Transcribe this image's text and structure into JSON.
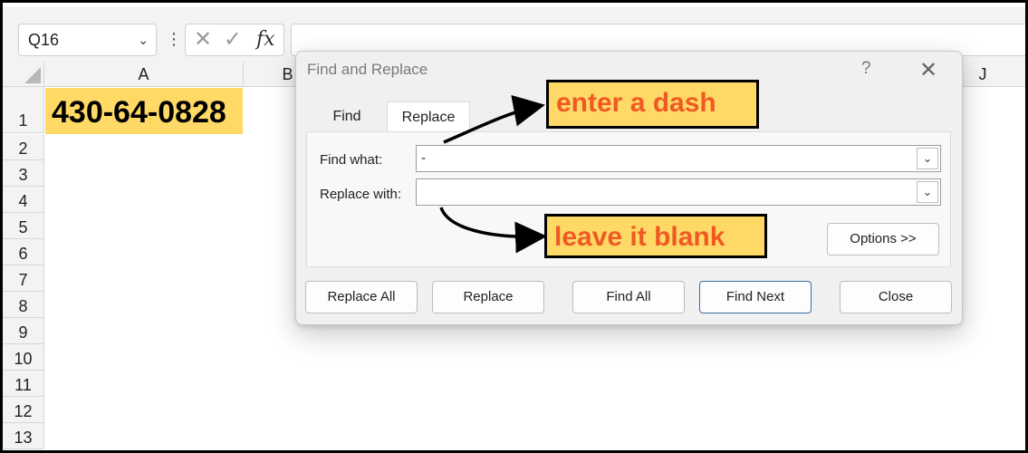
{
  "formula_bar": {
    "name_box": "Q16",
    "chevron": "⌄",
    "dots": "⋮",
    "cancel_icon": "✕",
    "enter_icon": "✓",
    "fx_label": "fx",
    "formula_value": ""
  },
  "grid": {
    "columns": [
      "A",
      "B",
      "J"
    ],
    "rows": [
      "1",
      "2",
      "3",
      "4",
      "5",
      "6",
      "7",
      "8",
      "9",
      "10",
      "11",
      "12",
      "13"
    ],
    "cell_a1": "430-64-0828",
    "cell_a1_fill": "#ffd966"
  },
  "dialog": {
    "title": "Find and Replace",
    "help": "?",
    "close": "✕",
    "tabs": [
      {
        "label": "Find",
        "active": false
      },
      {
        "label": "Replace",
        "active": true
      }
    ],
    "find_what_label": "Find what:",
    "find_what_value": "-",
    "replace_with_label": "Replace with:",
    "replace_with_value": "",
    "dropdown_icon": "⌄",
    "options_label": "Options >>",
    "buttons": {
      "replace_all": "Replace All",
      "replace": "Replace",
      "find_all": "Find All",
      "find_next": "Find Next",
      "close": "Close"
    }
  },
  "annotations": {
    "callout_1": "enter a dash",
    "callout_2": "leave it blank",
    "callout_fill": "#ffd966",
    "callout_text_color": "#ef5a24"
  }
}
